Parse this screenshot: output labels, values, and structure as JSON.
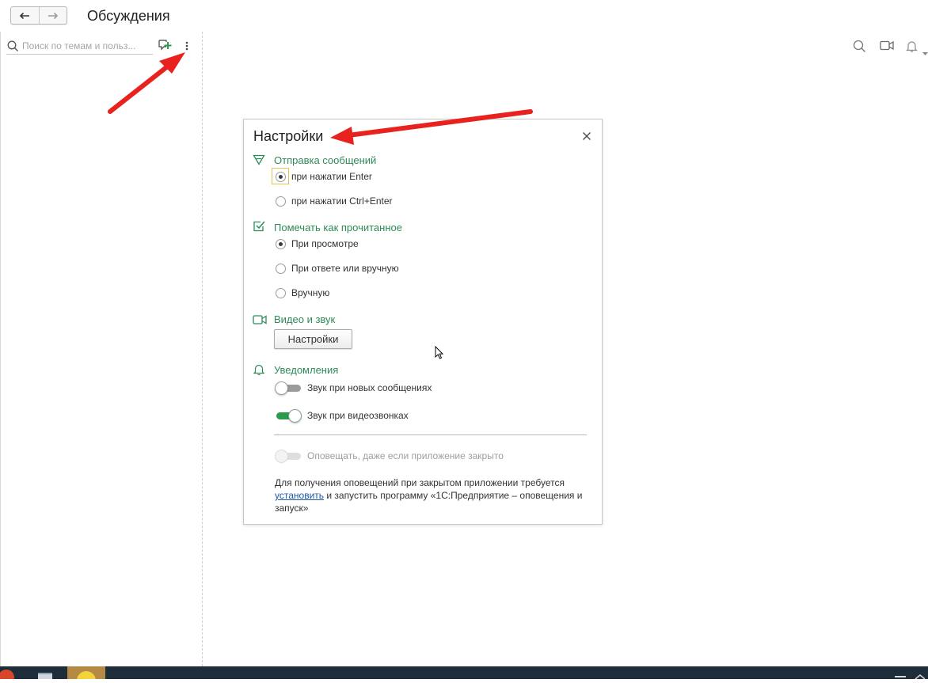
{
  "header": {
    "title": "Обсуждения",
    "back_icon": "arrow-left-icon",
    "forward_icon": "arrow-right-icon"
  },
  "sidebar": {
    "search": {
      "placeholder": "Поиск по темам и польз...",
      "value": ""
    },
    "add_icon": "add-discussion-icon",
    "more_icon": "more-vertical-icon"
  },
  "toolbar_right": [
    "search-icon",
    "video-camera-icon",
    "bell-icon"
  ],
  "dialog": {
    "title": "Настройки",
    "sections": {
      "sending": {
        "title": "Отправка сообщений",
        "options": [
          "при нажатии Enter",
          "при нажатии Ctrl+Enter"
        ],
        "selected": "при нажатии Enter"
      },
      "mark_read": {
        "title": "Помечать как прочитанное",
        "options": [
          "При просмотре",
          "При ответе или вручную",
          "Вручную"
        ],
        "selected": "При просмотре"
      },
      "video": {
        "title": "Видео и звук",
        "button_label": "Настройки"
      },
      "notifications": {
        "title": "Уведомления",
        "toggles": [
          {
            "label": "Звук при новых сообщениях",
            "on": false,
            "enabled": true
          },
          {
            "label": "Звук при видеозвонках",
            "on": true,
            "enabled": true
          },
          {
            "label": "Оповещать, даже если приложение закрыто",
            "on": false,
            "enabled": false
          }
        ],
        "note_before": "Для получения оповещений при закрытом приложении требуется ",
        "note_link": "установить",
        "note_after": " и запустить программу «1С:Предприятие – оповещения и запуск»"
      }
    }
  },
  "colors": {
    "accent_green": "#2e8b57",
    "toggle_on": "#2a9a4d",
    "annotation_red": "#e8231f",
    "link": "#1f57a8"
  }
}
